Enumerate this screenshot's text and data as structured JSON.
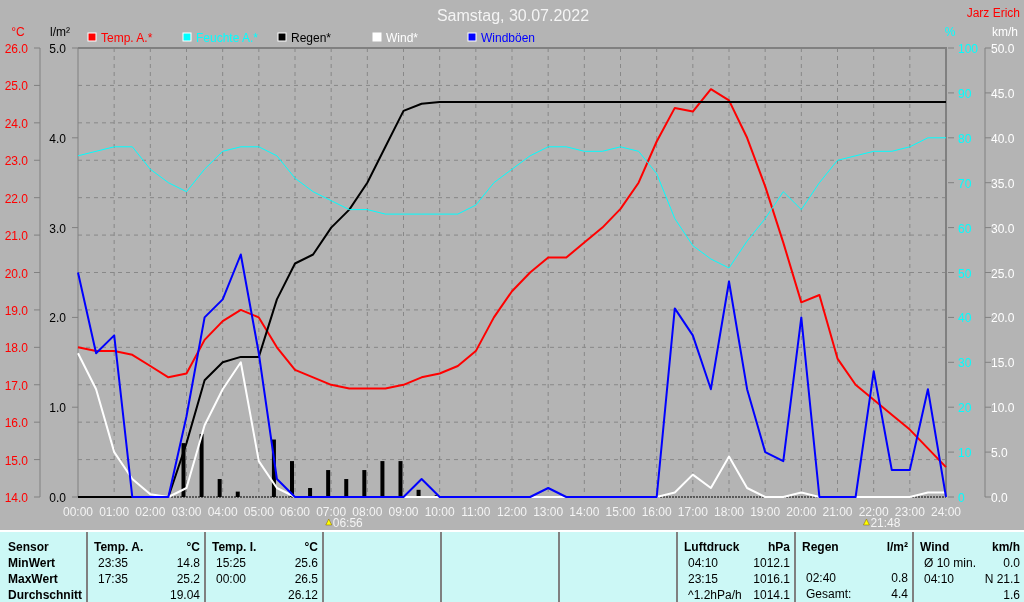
{
  "header": {
    "author": "Jarz Erich"
  },
  "chart": {
    "sunrise": "06:56",
    "sunset": "21:48",
    "layers": [
      {
        "chart_data": {
          "type": "line",
          "title": "Samstag, 30.07.2022",
          "grid": true,
          "legend": "top",
          "x": [
            0,
            0.5,
            1,
            1.5,
            2,
            2.5,
            3,
            3.5,
            4,
            4.5,
            5,
            5.5,
            6,
            6.5,
            7,
            7.5,
            8,
            8.5,
            9,
            9.5,
            10,
            10.5,
            11,
            11.5,
            12,
            12.5,
            13,
            13.5,
            14,
            14.5,
            15,
            15.5,
            16,
            16.5,
            17,
            17.5,
            18,
            18.5,
            19,
            19.5,
            20,
            20.5,
            21,
            21.5,
            22,
            22.5,
            23,
            23.5,
            24
          ],
          "xlim": [
            0,
            24
          ],
          "xticks": [
            {
              "value": 0,
              "label": "00:00"
            },
            {
              "value": 1,
              "label": "01:00"
            },
            {
              "value": 2,
              "label": "02:00"
            },
            {
              "value": 3,
              "label": "03:00"
            },
            {
              "value": 4,
              "label": "04:00"
            },
            {
              "value": 5,
              "label": "05:00"
            },
            {
              "value": 6,
              "label": "06:00"
            },
            {
              "value": 7,
              "label": "07:00"
            },
            {
              "value": 8,
              "label": "08:00"
            },
            {
              "value": 9,
              "label": "09:00"
            },
            {
              "value": 10,
              "label": "10:00"
            },
            {
              "value": 11,
              "label": "11:00"
            },
            {
              "value": 12,
              "label": "12:00"
            },
            {
              "value": 13,
              "label": "13:00"
            },
            {
              "value": 14,
              "label": "14:00"
            },
            {
              "value": 15,
              "label": "15:00"
            },
            {
              "value": 16,
              "label": "16:00"
            },
            {
              "value": 17,
              "label": "17:00"
            },
            {
              "value": 18,
              "label": "18:00"
            },
            {
              "value": 19,
              "label": "19:00"
            },
            {
              "value": 20,
              "label": "20:00"
            },
            {
              "value": 21,
              "label": "21:00"
            },
            {
              "value": 22,
              "label": "22:00"
            },
            {
              "value": 23,
              "label": "23:00"
            },
            {
              "value": 24,
              "label": "24:00"
            }
          ],
          "ylabel": "°C",
          "ylim": [
            14,
            26
          ],
          "yticks": [
            {
              "value": 26,
              "label": "26.0"
            },
            {
              "value": 25,
              "label": "25.0"
            },
            {
              "value": 24,
              "label": "24.0"
            },
            {
              "value": 23,
              "label": "23.0"
            },
            {
              "value": 22,
              "label": "22.0"
            },
            {
              "value": 21,
              "label": "21.0"
            },
            {
              "value": 20,
              "label": "20.0"
            },
            {
              "value": 19,
              "label": "19.0"
            },
            {
              "value": 18,
              "label": "18.0"
            },
            {
              "value": 17,
              "label": "17.0"
            },
            {
              "value": 16,
              "label": "16.0"
            },
            {
              "value": 15,
              "label": "15.0"
            },
            {
              "value": 14,
              "label": "14.0"
            }
          ],
          "y2label": "l/m²",
          "y2lim": [
            0,
            5
          ],
          "y2ticks": [
            {
              "value": 5,
              "label": "5.0"
            },
            {
              "value": 4,
              "label": "4.0"
            },
            {
              "value": 3,
              "label": "3.0"
            },
            {
              "value": 2,
              "label": "2.0"
            },
            {
              "value": 1,
              "label": "1.0"
            },
            {
              "value": 0,
              "label": "0.0"
            }
          ],
          "series": [
            {
              "name": "Temp. A.*",
              "color": "#ff0000",
              "values": [
                18.0,
                17.9,
                17.9,
                17.8,
                17.5,
                17.2,
                17.3,
                18.2,
                18.7,
                19.0,
                18.8,
                18.0,
                17.4,
                17.2,
                17.0,
                16.9,
                16.9,
                16.9,
                17.0,
                17.2,
                17.3,
                17.5,
                17.9,
                18.8,
                19.5,
                20.0,
                20.4,
                20.4,
                20.8,
                21.2,
                21.7,
                22.4,
                23.5,
                24.4,
                24.3,
                24.9,
                24.6,
                23.6,
                22.3,
                20.8,
                19.2,
                19.4,
                17.7,
                17.0,
                16.6,
                16.2,
                15.8,
                15.3,
                14.8
              ]
            },
            {
              "name": "Regen*",
              "color": "#000000",
              "axis": "y2",
              "values": [
                0,
                0,
                0,
                0,
                0,
                0,
                0.6,
                1.3,
                1.5,
                1.56,
                1.56,
                2.2,
                2.6,
                2.7,
                3.0,
                3.2,
                3.5,
                3.9,
                4.3,
                4.38,
                4.4,
                4.4,
                4.4,
                4.4,
                4.4,
                4.4,
                4.4,
                4.4,
                4.4,
                4.4,
                4.4,
                4.4,
                4.4,
                4.4,
                4.4,
                4.4,
                4.4,
                4.4,
                4.4,
                4.4,
                4.4,
                4.4,
                4.4,
                4.4,
                4.4,
                4.4,
                4.4,
                4.4,
                4.4
              ]
            }
          ]
        }
      },
      {
        "chart_data": {
          "type": "line",
          "legend": "top",
          "x": [
            0,
            0.5,
            1,
            1.5,
            2,
            2.5,
            3,
            3.5,
            4,
            4.5,
            5,
            5.5,
            6,
            6.5,
            7,
            7.5,
            8,
            8.5,
            9,
            9.5,
            10,
            10.5,
            11,
            11.5,
            12,
            12.5,
            13,
            13.5,
            14,
            14.5,
            15,
            15.5,
            16,
            16.5,
            17,
            17.5,
            18,
            18.5,
            19,
            19.5,
            20,
            20.5,
            21,
            21.5,
            22,
            22.5,
            23,
            23.5,
            24
          ],
          "xlim": [
            0,
            24
          ],
          "ylabel": "%",
          "ylim": [
            0,
            100
          ],
          "yticks": [
            {
              "value": 100,
              "label": "100"
            },
            {
              "value": 90,
              "label": "90"
            },
            {
              "value": 80,
              "label": "80"
            },
            {
              "value": 70,
              "label": "70"
            },
            {
              "value": 60,
              "label": "60"
            },
            {
              "value": 50,
              "label": "50"
            },
            {
              "value": 40,
              "label": "40"
            },
            {
              "value": 30,
              "label": "30"
            },
            {
              "value": 20,
              "label": "20"
            },
            {
              "value": 10,
              "label": "10"
            },
            {
              "value": 0,
              "label": "0"
            }
          ],
          "y2label": "km/h",
          "y2lim": [
            0,
            50
          ],
          "y2ticks": [
            {
              "value": 50,
              "label": "50.0"
            },
            {
              "value": 45,
              "label": "45.0"
            },
            {
              "value": 40,
              "label": "40.0"
            },
            {
              "value": 35,
              "label": "35.0"
            },
            {
              "value": 30,
              "label": "30.0"
            },
            {
              "value": 25,
              "label": "25.0"
            },
            {
              "value": 20,
              "label": "20.0"
            },
            {
              "value": 15,
              "label": "15.0"
            },
            {
              "value": 10,
              "label": "10.0"
            },
            {
              "value": 5,
              "label": "5.0"
            },
            {
              "value": 0,
              "label": "0.0"
            }
          ],
          "series": [
            {
              "name": "Feuchte A.*",
              "color": "#00ffff",
              "values": [
                76,
                77,
                78,
                78,
                73,
                70,
                68,
                73,
                77,
                78,
                78,
                76,
                71,
                68,
                66,
                64,
                64,
                63,
                63,
                63,
                63,
                63,
                65,
                70,
                73,
                76,
                78,
                78,
                77,
                77,
                78,
                77,
                72,
                62,
                56,
                53,
                51,
                57,
                62,
                68,
                64,
                70,
                75,
                76,
                77,
                77,
                78,
                80,
                80
              ]
            },
            {
              "name": "Wind*",
              "color": "#ffffff",
              "axis": "y2",
              "values": [
                16,
                12,
                5,
                2,
                0.3,
                0,
                1,
                8,
                12,
                15,
                4,
                1,
                0,
                0,
                0,
                0,
                0,
                0,
                0,
                0,
                0,
                0,
                0,
                0,
                0,
                0,
                0,
                0,
                0,
                0,
                0,
                0,
                0,
                0.5,
                2.5,
                1,
                4.5,
                1,
                0,
                0,
                0.5,
                0,
                0,
                0,
                0,
                0,
                0,
                0.5,
                0.5
              ]
            },
            {
              "name": "Windböen",
              "color": "#0000ff",
              "axis": "y2",
              "values": [
                25,
                16,
                18,
                0,
                0,
                0,
                9,
                20,
                22,
                27,
                16,
                2,
                0,
                0,
                0,
                0,
                0,
                0,
                0,
                2,
                0,
                0,
                0,
                0,
                0,
                0,
                1,
                0,
                0,
                0,
                0,
                0,
                0,
                21,
                18,
                12,
                24,
                12,
                5,
                4,
                20,
                0,
                0,
                0,
                14,
                3,
                3,
                12,
                0
              ]
            }
          ]
        }
      }
    ]
  },
  "table": {
    "row_labels": [
      "Sensor",
      "MinWert",
      "MaxWert",
      "Durchschnitt"
    ],
    "sections": [
      {
        "columns": [
          "Temp. A.",
          "°C"
        ],
        "rows": [
          [
            "23:35",
            "14.8"
          ],
          [
            "17:35",
            "25.2"
          ],
          [
            null,
            "19.04"
          ]
        ]
      },
      {
        "columns": [
          "Temp. I.",
          "°C"
        ],
        "rows": [
          [
            "15:25",
            "25.6"
          ],
          [
            "00:00",
            "26.5"
          ],
          [
            null,
            "26.12"
          ]
        ]
      },
      {
        "columns": [
          "Luftdruck",
          "hPa"
        ],
        "rows": [
          [
            "04:10",
            "1012.1"
          ],
          [
            "23:15",
            "1016.1"
          ],
          [
            "^1.2hPa/h",
            "1014.1"
          ]
        ]
      },
      {
        "columns": [
          "Regen",
          "l/m²"
        ],
        "rows": [
          [
            null,
            null
          ],
          [
            "02:40",
            "0.8"
          ],
          [
            "Gesamt:",
            "4.4"
          ]
        ]
      },
      {
        "columns": [
          "Wind",
          "km/h"
        ],
        "rows": [
          [
            "Ø 10 min.",
            "0.0"
          ],
          [
            "04:10",
            "N 21.1"
          ],
          [
            null,
            "1.6"
          ]
        ]
      }
    ]
  }
}
